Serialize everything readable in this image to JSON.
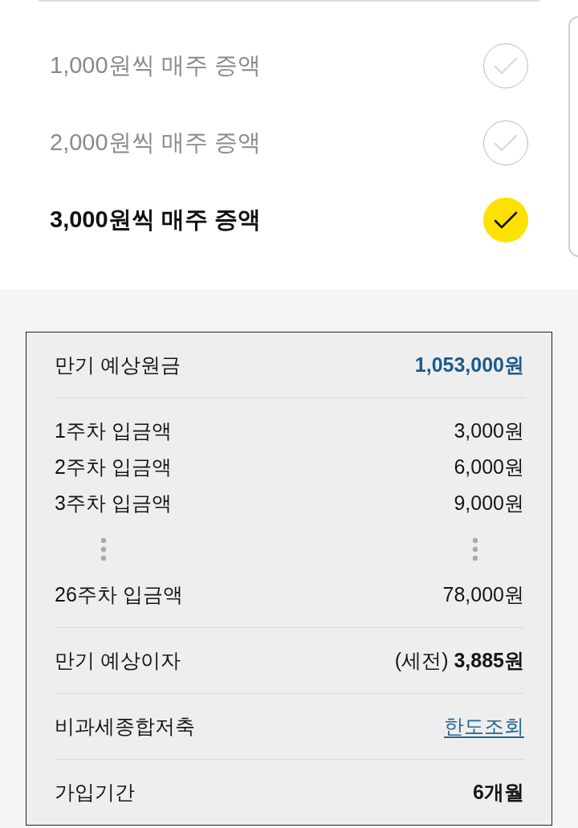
{
  "options": [
    {
      "label": "1,000원씩 매주 증액",
      "selected": false
    },
    {
      "label": "2,000원씩 매주 증액",
      "selected": false
    },
    {
      "label": "3,000원씩 매주 증액",
      "selected": true
    }
  ],
  "summary": {
    "sections": [
      {
        "rows": [
          {
            "kind": "total",
            "label": "만기 예상원금",
            "value": "1,053,000원"
          }
        ]
      },
      {
        "rows": [
          {
            "kind": "amount",
            "label": "1주차 입금액",
            "value": "3,000원"
          },
          {
            "kind": "amount",
            "label": "2주차 입금액",
            "value": "6,000원"
          },
          {
            "kind": "amount",
            "label": "3주차 입금액",
            "value": "9,000원"
          },
          {
            "kind": "gap"
          },
          {
            "kind": "amount",
            "label": "26주차 입금액",
            "value": "78,000원"
          }
        ]
      },
      {
        "rows": [
          {
            "kind": "rich",
            "label": "만기 예상이자",
            "value": "(세전) **3,885원**"
          }
        ]
      },
      {
        "rows": [
          {
            "kind": "link",
            "label": "비과세종합저축",
            "value": "한도조회"
          }
        ]
      },
      {
        "rows": [
          {
            "kind": "emphasis",
            "label": "가입기간",
            "value": "6개월"
          }
        ]
      }
    ]
  }
}
